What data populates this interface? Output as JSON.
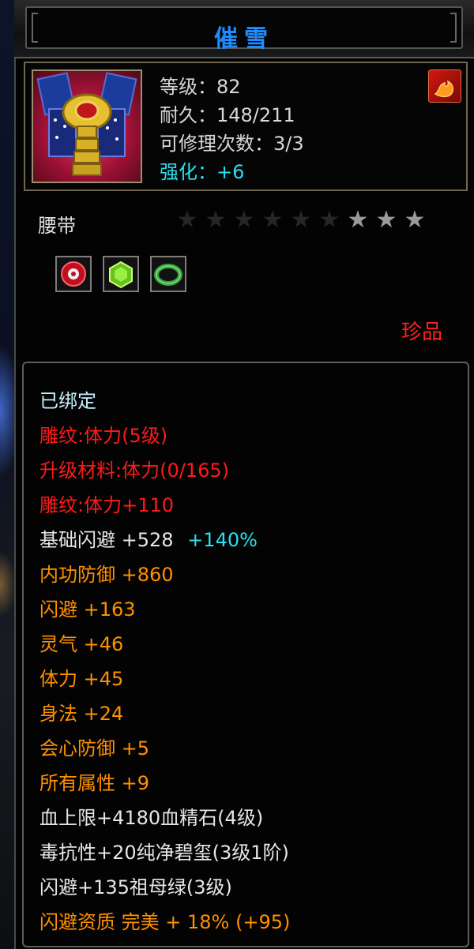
{
  "title": "催雪",
  "header": {
    "level": "等级：82",
    "durability": "耐久：148/211",
    "repairs": "可修理次数：3/3",
    "enhance": "强化：+6"
  },
  "item_type": "腰带",
  "stars": {
    "total": 9,
    "lit": 3
  },
  "gems": [
    "red-gem-icon",
    "green-cube-gem-icon",
    "green-ring-gem-icon"
  ],
  "rarity": "珍品",
  "attributes": {
    "bound": "已绑定",
    "engrave": "雕纹:体力(5级)",
    "upgrade_material": "升级材料:体力(0/165)",
    "engrave_bonus": "雕纹:体力+110",
    "base_dodge": "基础闪避 +528",
    "base_dodge_extra": "+140%",
    "inner_defense": "内功防御 +860",
    "dodge": "闪避 +163",
    "spirit": "灵气 +46",
    "stamina": "体力 +45",
    "agility": "身法 +24",
    "crit_defense": "会心防御 +5",
    "all_attr": "所有属性 +9",
    "hp_gem": "血上限+4180血精石(4级)",
    "poison_gem": "毒抗性+20纯净碧玺(3级1阶)",
    "dodge_gem": "闪避+135祖母绿(3级)",
    "dodge_quality": "闪避资质 完美 + 18% (+95)"
  },
  "colors": {
    "title": "#1f8cff",
    "cyan": "#28e0f0",
    "red": "#ff1a1a",
    "orange": "#ff9000",
    "white": "#e6e6e6"
  }
}
